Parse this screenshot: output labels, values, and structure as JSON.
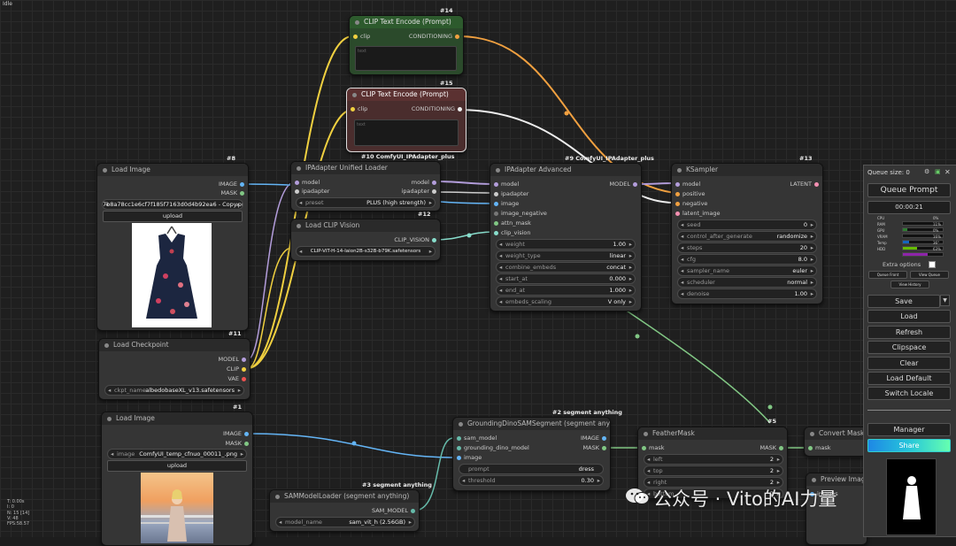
{
  "status": "Idle",
  "corner_stats": [
    "T: 0.00s",
    "I: 0",
    "N: 15 [14]",
    "V: 48",
    "FPS:58.57"
  ],
  "watermark": "公众号 · Vito的AI力量",
  "nodes": {
    "clip_pos": {
      "id": "#14",
      "title": "CLIP Text Encode (Prompt)",
      "in": "clip",
      "out": "CONDITIONING",
      "placeholder": "text"
    },
    "clip_neg": {
      "id": "#15",
      "title": "CLIP Text Encode (Prompt)",
      "in": "clip",
      "out": "CONDITIONING",
      "placeholder": "text"
    },
    "load_image1": {
      "id": "#8",
      "title": "Load Image",
      "out1": "IMAGE",
      "out2": "MASK",
      "image": "7b8a78cc1e6cf7f185f7163d0d4b92ea6 - Copy.png",
      "upload": "upload"
    },
    "ipa_loader": {
      "id": "#10",
      "group": "ComfyUI_IPAdapter_plus",
      "title": "IPAdapter Unified Loader",
      "in1": "model",
      "in2": "ipadapter",
      "out1": "model",
      "out2": "ipadapter",
      "preset_label": "preset",
      "preset_value": "PLUS (high strength)"
    },
    "clip_vision": {
      "id": "#12",
      "title": "Load CLIP Vision",
      "out": "CLIP_VISION",
      "value": "CLIP-ViT-H-14-laion2B-s32B-b79K.safetensors"
    },
    "ipa_adv": {
      "id": "#9",
      "group": "ComfyUI_IPAdapter_plus",
      "title": "IPAdapter Advanced",
      "out": "MODEL",
      "inputs": [
        "model",
        "ipadapter",
        "image",
        "image_negative",
        "attn_mask",
        "clip_vision"
      ],
      "widgets": [
        {
          "label": "weight",
          "value": "1.00"
        },
        {
          "label": "weight_type",
          "value": "linear"
        },
        {
          "label": "combine_embeds",
          "value": "concat"
        },
        {
          "label": "start_at",
          "value": "0.000"
        },
        {
          "label": "end_at",
          "value": "1.000"
        },
        {
          "label": "embeds_scaling",
          "value": "V only"
        }
      ]
    },
    "ksampler": {
      "id": "#13",
      "title": "KSampler",
      "out": "LATENT",
      "inputs": [
        "model",
        "positive",
        "negative",
        "latent_image"
      ],
      "widgets": [
        {
          "label": "seed",
          "value": "0"
        },
        {
          "label": "control_after_generate",
          "value": "randomize"
        },
        {
          "label": "steps",
          "value": "20"
        },
        {
          "label": "cfg",
          "value": "8.0"
        },
        {
          "label": "sampler_name",
          "value": "euler"
        },
        {
          "label": "scheduler",
          "value": "normal"
        },
        {
          "label": "denoise",
          "value": "1.00"
        }
      ]
    },
    "checkpoint": {
      "id": "#11",
      "title": "Load Checkpoint",
      "out1": "MODEL",
      "out2": "CLIP",
      "out3": "VAE",
      "label": "ckpt_name",
      "value": "albedobaseXL_v13.safetensors"
    },
    "load_image2": {
      "id": "#1",
      "title": "Load Image",
      "out1": "IMAGE",
      "out2": "MASK",
      "label": "image",
      "value": "ComfyUI_temp_cfnuo_00011_.png",
      "upload": "upload"
    },
    "grounding": {
      "id": "#2",
      "group": "segment anything",
      "title": "GroundingDinoSAMSegment (segment anything)",
      "in1": "sam_model",
      "in2": "grounding_dino_model",
      "in3": "image",
      "out1": "IMAGE",
      "out2": "MASK",
      "prompt_label": "prompt",
      "prompt_value": "dress",
      "thr_label": "threshold",
      "thr_value": "0.30"
    },
    "sam_loader": {
      "id": "#3",
      "group": "segment anything",
      "title": "SAMModelLoader (segment anything)",
      "out": "SAM_MODEL",
      "label": "model_name",
      "value": "sam_vit_h (2.56GB)"
    },
    "feather": {
      "id": "#5",
      "title": "FeatherMask",
      "in": "mask",
      "out": "MASK",
      "widgets": [
        {
          "label": "left",
          "value": "2"
        },
        {
          "label": "top",
          "value": "2"
        },
        {
          "label": "right",
          "value": "2"
        },
        {
          "label": "bottom",
          "value": "2"
        }
      ]
    },
    "convert": {
      "title": "Convert Mask t",
      "in": "mask"
    },
    "preview": {
      "title": "Preview Image",
      "in": "images"
    }
  },
  "panel": {
    "queue_label": "Queue size: 0",
    "queue_prompt": "Queue Prompt",
    "timer": "00:00:21",
    "stats": [
      {
        "name": "CPU",
        "value": "0%",
        "pct": 0,
        "color": "#2e7d32"
      },
      {
        "name": "RAM",
        "value": "11%",
        "pct": 11,
        "color": "#2e7d32"
      },
      {
        "name": "GPU",
        "value": "0%",
        "pct": 0,
        "color": "#2e7d32"
      },
      {
        "name": "VRAM",
        "value": "16%",
        "pct": 16,
        "color": "#1565c0"
      },
      {
        "name": "Temp",
        "value": "36°",
        "pct": 36,
        "color": "#66bb00"
      },
      {
        "name": "HDD",
        "value": "63%",
        "pct": 63,
        "color": "#8e24aa"
      }
    ],
    "extra_options": "Extra options",
    "queue_front": "Queue Front",
    "view_queue": "View Queue",
    "view_history": "View History",
    "save": "Save",
    "load": "Load",
    "refresh": "Refresh",
    "clipspace": "Clipspace",
    "clear": "Clear",
    "load_default": "Load Default",
    "switch_locale": "Switch Locale",
    "manager": "Manager",
    "share": "Share"
  }
}
